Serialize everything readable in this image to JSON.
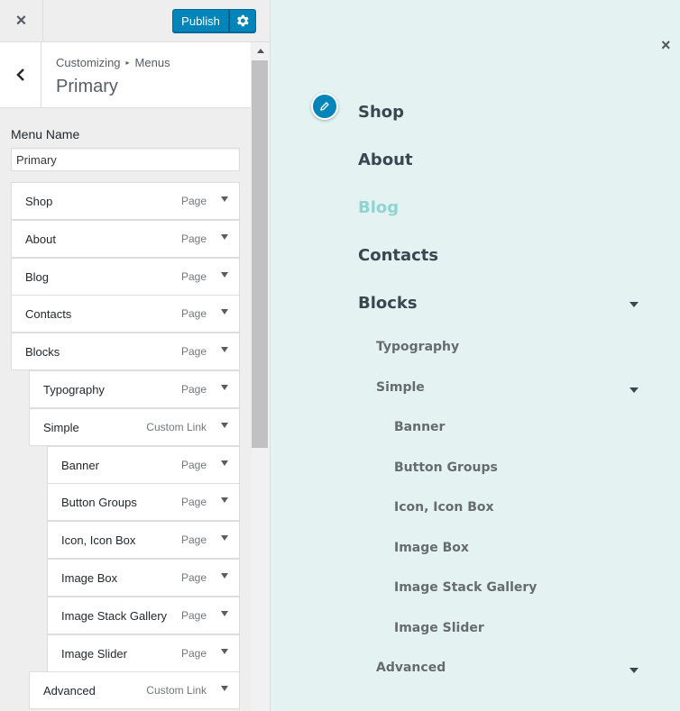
{
  "topbar": {
    "close_icon": "×",
    "publish_label": "Publish"
  },
  "panel": {
    "breadcrumb_root": "Customizing",
    "breadcrumb_sep": "▸",
    "breadcrumb_section": "Menus",
    "title": "Primary"
  },
  "menu_name": {
    "label": "Menu Name",
    "value": "Primary"
  },
  "menu_items": [
    {
      "title": "Shop",
      "type": "Page",
      "depth": 0
    },
    {
      "title": "About",
      "type": "Page",
      "depth": 0
    },
    {
      "title": "Blog",
      "type": "Page",
      "depth": 0
    },
    {
      "title": "Contacts",
      "type": "Page",
      "depth": 0
    },
    {
      "title": "Blocks",
      "type": "Page",
      "depth": 0
    },
    {
      "title": "Typography",
      "type": "Page",
      "depth": 1
    },
    {
      "title": "Simple",
      "type": "Custom Link",
      "depth": 1
    },
    {
      "title": "Banner",
      "type": "Page",
      "depth": 2
    },
    {
      "title": "Button Groups",
      "type": "Page",
      "depth": 2
    },
    {
      "title": "Icon, Icon Box",
      "type": "Page",
      "depth": 2
    },
    {
      "title": "Image Box",
      "type": "Page",
      "depth": 2
    },
    {
      "title": "Image Stack Gallery",
      "type": "Page",
      "depth": 2
    },
    {
      "title": "Image Slider",
      "type": "Page",
      "depth": 2
    },
    {
      "title": "Advanced",
      "type": "Custom Link",
      "depth": 1
    }
  ],
  "preview": {
    "close_icon": "×",
    "nav": [
      {
        "label": "Shop",
        "level": 0,
        "has_children": false,
        "active": false
      },
      {
        "label": "About",
        "level": 0,
        "has_children": false,
        "active": false
      },
      {
        "label": "Blog",
        "level": 0,
        "has_children": false,
        "active": true
      },
      {
        "label": "Contacts",
        "level": 0,
        "has_children": false,
        "active": false
      },
      {
        "label": "Blocks",
        "level": 0,
        "has_children": true,
        "active": false
      },
      {
        "label": "Typography",
        "level": 1,
        "has_children": false,
        "active": false
      },
      {
        "label": "Simple",
        "level": 1,
        "has_children": true,
        "active": false
      },
      {
        "label": "Banner",
        "level": 2,
        "has_children": false,
        "active": false
      },
      {
        "label": "Button Groups",
        "level": 2,
        "has_children": false,
        "active": false
      },
      {
        "label": "Icon, Icon Box",
        "level": 2,
        "has_children": false,
        "active": false
      },
      {
        "label": "Image Box",
        "level": 2,
        "has_children": false,
        "active": false
      },
      {
        "label": "Image Stack Gallery",
        "level": 2,
        "has_children": false,
        "active": false
      },
      {
        "label": "Image Slider",
        "level": 2,
        "has_children": false,
        "active": false
      },
      {
        "label": "Advanced",
        "level": 1,
        "has_children": true,
        "active": false
      }
    ]
  },
  "colors": {
    "accent": "#0085ba",
    "preview_bg": "#e4f3f2",
    "active_link": "#8fd4d1",
    "nav_text": "#3a4750"
  }
}
